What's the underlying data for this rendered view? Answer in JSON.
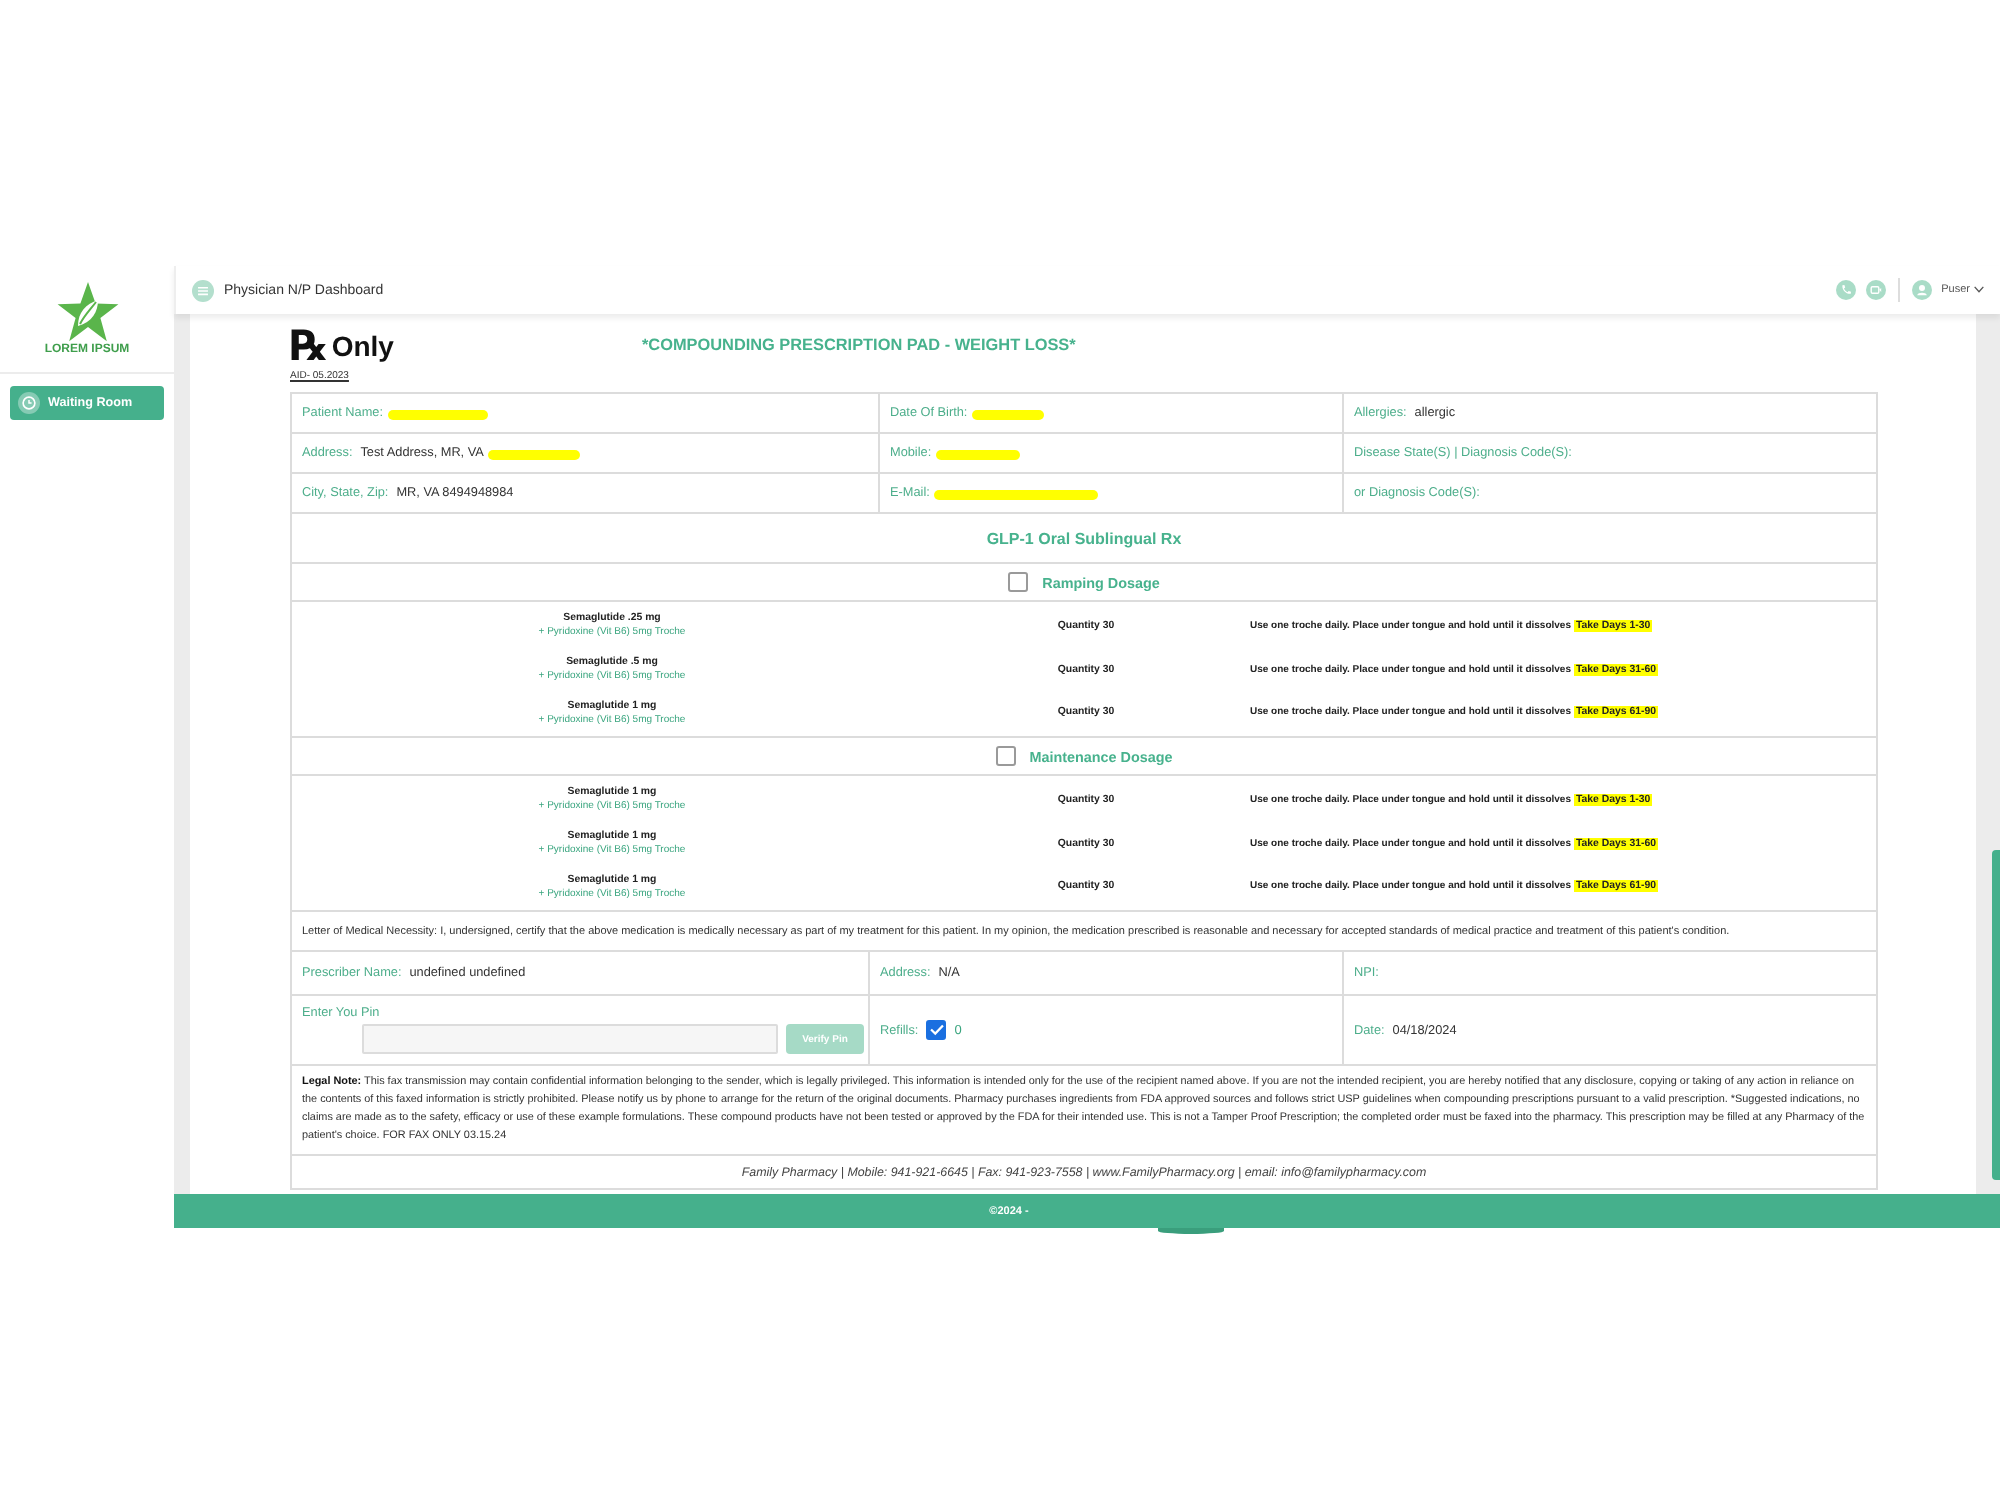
{
  "sidebar": {
    "logo_text": "LOREM IPSUM",
    "items": [
      {
        "label": "Waiting Room",
        "selected": true
      }
    ]
  },
  "topbar": {
    "title": "Physician N/P Dashboard",
    "user": "Puser"
  },
  "form": {
    "rx_logo": {
      "symbol": "℞",
      "text": "Only"
    },
    "code": "AID- 05.2023",
    "title": "*COMPOUNDING PRESCRIPTION PAD - WEIGHT LOSS*",
    "patient_fields": [
      {
        "label": "Patient Name:",
        "redacted": true
      },
      {
        "label": "Date Of Birth:",
        "redacted": true
      },
      {
        "label": "Allergies:",
        "value": "allergic",
        "redacted": false
      },
      {
        "label": "Address:",
        "value": "Test Address, MR, VA",
        "redacted": true
      },
      {
        "label": "Mobile:",
        "redacted": true
      },
      {
        "label": "Disease State(S) | Diagnosis Code(S):",
        "redacted": false
      },
      {
        "label": "City, State, Zip:",
        "value": "MR, VA 8494948984",
        "redacted": false
      },
      {
        "label": "E-Mail:",
        "redacted": true
      },
      {
        "label": "or Diagnosis Code(S):",
        "redacted": false
      }
    ],
    "section_title": "GLP-1 Oral Sublingual Rx",
    "dosage_groups": [
      {
        "label": "Ramping Dosage",
        "checked": false,
        "items": [
          {
            "drug": "Semaglutide .25 mg",
            "additive": "+ Pyridoxine (Vit B6) 5mg Troche",
            "quantity": "Quantity 30",
            "instructions": "Use one troche daily. Place under tongue and hold until it dissolves",
            "days": "Take Days 1-30"
          },
          {
            "drug": "Semaglutide .5 mg",
            "additive": "+ Pyridoxine (Vit B6) 5mg Troche",
            "quantity": "Quantity 30",
            "instructions": "Use one troche daily. Place under tongue and hold until it dissolves",
            "days": "Take Days 31-60"
          },
          {
            "drug": "Semaglutide 1 mg",
            "additive": "+ Pyridoxine (Vit B6) 5mg Troche",
            "quantity": "Quantity 30",
            "instructions": "Use one troche daily. Place under tongue and hold until it dissolves",
            "days": "Take Days 61-90"
          }
        ]
      },
      {
        "label": "Maintenance Dosage",
        "checked": false,
        "items": [
          {
            "drug": "Semaglutide 1 mg",
            "additive": "+ Pyridoxine (Vit B6) 5mg Troche",
            "quantity": "Quantity 30",
            "instructions": "Use one troche daily. Place under tongue and hold until it dissolves",
            "days": "Take Days 1-30"
          },
          {
            "drug": "Semaglutide 1 mg",
            "additive": "+ Pyridoxine (Vit B6) 5mg Troche",
            "quantity": "Quantity 30",
            "instructions": "Use one troche daily. Place under tongue and hold until it dissolves",
            "days": "Take Days 31-60"
          },
          {
            "drug": "Semaglutide 1 mg",
            "additive": "+ Pyridoxine (Vit B6) 5mg Troche",
            "quantity": "Quantity 30",
            "instructions": "Use one troche daily. Place under tongue and hold until it dissolves",
            "days": "Take Days 61-90"
          }
        ]
      }
    ],
    "necessity_letter": "Letter of Medical Necessity: I, undersigned, certify that the above medication is medically necessary as part of my treatment for this patient. In my opinion, the medication prescribed is reasonable and necessary for accepted standards of medical practice and treatment of this patient's condition.",
    "prescriber_fields": [
      {
        "label": "Prescriber Name:",
        "value": "undefined undefined"
      },
      {
        "label": "Address:",
        "value": "N/A"
      },
      {
        "label": "NPI:"
      }
    ],
    "pin": {
      "label": "Enter You Pin",
      "button": "Verify Pin",
      "disabled": true
    },
    "refills": {
      "label": "Refills:",
      "checked": true,
      "value": "0"
    },
    "date": {
      "label": "Date:",
      "value": "04/18/2024"
    },
    "legal_note": {
      "label": "Legal Note:",
      "text": "This fax transmission may contain confidential information belonging to the sender, which is legally privileged. This information is intended only for the use of the recipient named above. If you are not the intended recipient, you are hereby notified that any disclosure, copying or taking of any action in reliance on the contents of this faxed information is strictly prohibited. Please notify us by phone to arrange for the return of the original documents. Pharmacy purchases ingredients from FDA approved sources and follows strict USP guidelines when compounding prescriptions pursuant to a valid prescription. *Suggested indications, no claims are made as to the safety, efficacy or use of these example formulations. These compound products have not been tested or approved by the FDA for their intended use. This is not a Tamper Proof Prescription; the completed order must be faxed into the pharmacy. This prescription may be filled at any Pharmacy of the patient's choice. FOR FAX ONLY 03.15.24"
    },
    "pharmacy_line": "Family Pharmacy | Mobile: 941-921-6645 | Fax: 941-923-7558 | www.FamilyPharmacy.org | email: info@familypharmacy.com"
  },
  "footer": {
    "text": "©2024 -"
  }
}
